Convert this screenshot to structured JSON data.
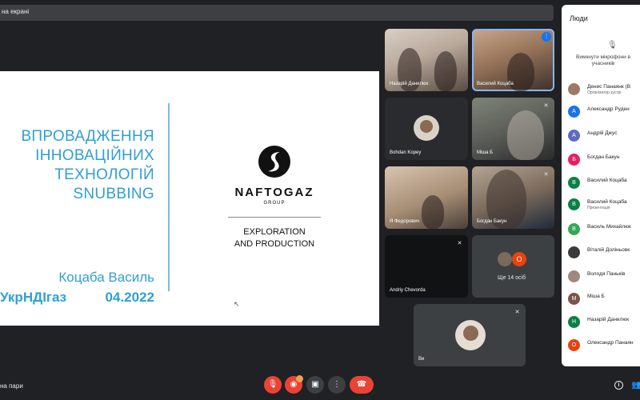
{
  "present_bar": {
    "label": "на екрані"
  },
  "slide": {
    "title_lines": [
      "ВПРОВАДЖЕННЯ",
      "ІННОВАЦІЙНИХ",
      "ТЕХНОЛОГІЙ",
      "SNUBBING"
    ],
    "author": "Коцаба Василь",
    "org": "УкрНДІгаз",
    "date": "04.2022",
    "logo_name": "NAFTOGAZ",
    "logo_group": "GROUP",
    "logo_sub": [
      "EXPLORATION",
      "AND PRODUCTION"
    ]
  },
  "tiles": [
    {
      "name": "Назарій Данилюк"
    },
    {
      "name": "Василий Коцаба"
    },
    {
      "name": "Bohdan Kopey"
    },
    {
      "name": "Міша Б"
    },
    {
      "name": "Я Федорович"
    },
    {
      "name": "Богдан Бакун"
    },
    {
      "name": "Andriy Chevorda"
    },
    {
      "name": "Ви"
    }
  ],
  "more": {
    "label": "Ще 14 осіб",
    "avatar_letter": "О"
  },
  "panel": {
    "title": "Люди",
    "mute_text": [
      "Вимкнути мікрофони в",
      "учасників"
    ],
    "people": [
      {
        "name": "Денис Панаянк (В",
        "role": "Організатор зустрі",
        "letter": "",
        "color": "#9c7b66"
      },
      {
        "name": "Александр Руден",
        "role": "",
        "letter": "А",
        "color": "#1a73e8"
      },
      {
        "name": "Андрій Джус",
        "role": "",
        "letter": "А",
        "color": "#5c6bc0"
      },
      {
        "name": "Богдан Бакун",
        "role": "",
        "letter": "Б",
        "color": "#e91e63"
      },
      {
        "name": "Василий Коцаба",
        "role": "",
        "letter": "В",
        "color": "#0b8043"
      },
      {
        "name": "Василий Коцаба",
        "role": "Презентація",
        "letter": "В",
        "color": "#0b8043"
      },
      {
        "name": "Василь Михайлюк",
        "role": "",
        "letter": "В",
        "color": "#33a852"
      },
      {
        "name": "Віталій Доліньовк",
        "role": "",
        "letter": "",
        "color": "#3a3a3a"
      },
      {
        "name": "Володя Паньків",
        "role": "",
        "letter": "",
        "color": "#a1887f"
      },
      {
        "name": "Міша Б",
        "role": "",
        "letter": "М",
        "color": "#795548"
      },
      {
        "name": "Назарій Данилюк",
        "role": "",
        "letter": "Н",
        "color": "#0b8043"
      },
      {
        "name": "Олександр Панаян",
        "role": "",
        "letter": "О",
        "color": "#e8430e"
      }
    ]
  },
  "bottom": {
    "label": "на пари"
  }
}
